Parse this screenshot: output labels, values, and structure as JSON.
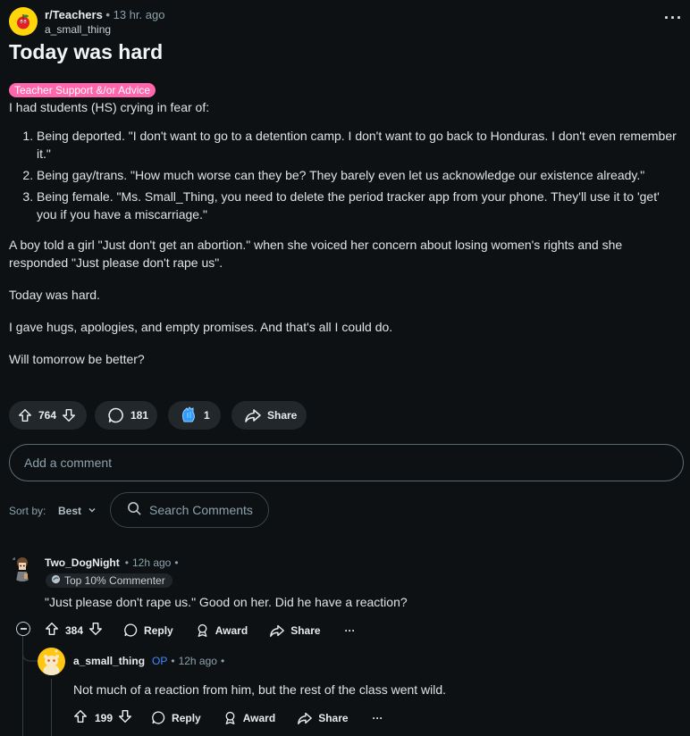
{
  "post": {
    "subreddit": "r/Teachers",
    "sep": "•",
    "time": "13 hr. ago",
    "author": "a_small_thing",
    "more": "···",
    "title": "Today was hard",
    "flair": "Teacher Support &/or Advice",
    "intro": "I had students (HS) crying in fear of:",
    "list": [
      "Being deported. \"I don't want to go to a detention camp. I don't want to go back to Honduras. I don't even remember it.\"",
      "Being gay/trans. \"How much worse can they be? They barely even let us acknowledge our existence already.\"",
      "Being female. \"Ms. Small_Thing, you need to delete the period tracker app from your phone. They'll use it to 'get' you if you have a miscarriage.\""
    ],
    "para1": "A boy told a girl \"Just don't get an abortion.\" when she voiced her concern about losing women's rights and she responded \"Just please don't rape us\".",
    "para2": "Today was hard.",
    "para3": "I gave hugs, apologies, and empty promises. And that's all I could do.",
    "para4": "Will tomorrow be better?",
    "votes": "764",
    "comments": "181",
    "awards": "1",
    "share": "Share"
  },
  "comment_box": {
    "placeholder": "Add a comment"
  },
  "sort": {
    "label": "Sort by:",
    "value": "Best",
    "search_placeholder": "Search Comments"
  },
  "comments": [
    {
      "author": "Two_DogNight",
      "sep": "•",
      "time": "12h ago",
      "badge": "Top 10% Commenter",
      "text": "\"Just please don't rape us.\" Good on her. Did he have a reaction?",
      "votes": "384",
      "reply": "Reply",
      "award": "Award",
      "share": "Share",
      "more": "···"
    },
    {
      "author": "a_small_thing",
      "op": "OP",
      "sep": "•",
      "time": "12h ago",
      "text": "Not much of a reaction from him, but the rest of the class went wild.",
      "votes": "199",
      "reply": "Reply",
      "award": "Award",
      "share": "Share",
      "more": "···"
    }
  ],
  "colors": {
    "background": "#0e1113",
    "flair": "#ff66ac",
    "op": "#3d8bff",
    "subreddit_icon": "#ffd60a"
  }
}
